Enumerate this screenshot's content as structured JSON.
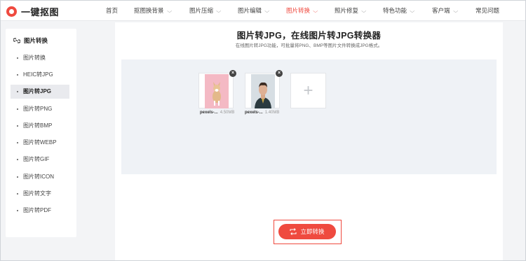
{
  "logo": {
    "text": "一键抠图",
    "icon": "logo-ring-icon",
    "color": "#ef4a3f"
  },
  "nav": {
    "items": [
      {
        "label": "首页",
        "caret": false,
        "active": false
      },
      {
        "label": "抠图换背景",
        "caret": true,
        "active": false
      },
      {
        "label": "图片压缩",
        "caret": true,
        "active": false
      },
      {
        "label": "图片编辑",
        "caret": true,
        "active": false
      },
      {
        "label": "图片转换",
        "caret": true,
        "active": true
      },
      {
        "label": "照片修复",
        "caret": true,
        "active": false
      },
      {
        "label": "特色功能",
        "caret": true,
        "active": false
      },
      {
        "label": "客户端",
        "caret": true,
        "active": false
      },
      {
        "label": "常见问题",
        "caret": false,
        "active": false
      }
    ]
  },
  "sidebar": {
    "heading": "图片转换",
    "heading_icon": "convert-link-icon",
    "items": [
      {
        "label": "图片转换",
        "active": false
      },
      {
        "label": "HEIC转JPG",
        "active": false
      },
      {
        "label": "图片转JPG",
        "active": true
      },
      {
        "label": "图片转PNG",
        "active": false
      },
      {
        "label": "图片转BMP",
        "active": false
      },
      {
        "label": "图片转WEBP",
        "active": false
      },
      {
        "label": "图片转GIF",
        "active": false
      },
      {
        "label": "图片转ICON",
        "active": false
      },
      {
        "label": "图片转文字",
        "active": false
      },
      {
        "label": "图片转PDF",
        "active": false
      }
    ]
  },
  "main": {
    "title": "图片转JPG，在线图片转JPG转换器",
    "subtitle": "在线图片转JPG功能，可批量将PNG、BMP等图片文件转换成JPG格式。",
    "files": [
      {
        "name": "pexels-...",
        "size": "4.50MB",
        "thumb": "dog-photo-thumbnail"
      },
      {
        "name": "pexels-...",
        "size": "1.40MB",
        "thumb": "man-portrait-thumbnail"
      }
    ],
    "add_symbol": "+",
    "convert_button": "立即转换"
  },
  "colors": {
    "accent": "#ef4a3f",
    "upload_bg": "#eff2f6",
    "page_bg": "#f3f4f6"
  }
}
